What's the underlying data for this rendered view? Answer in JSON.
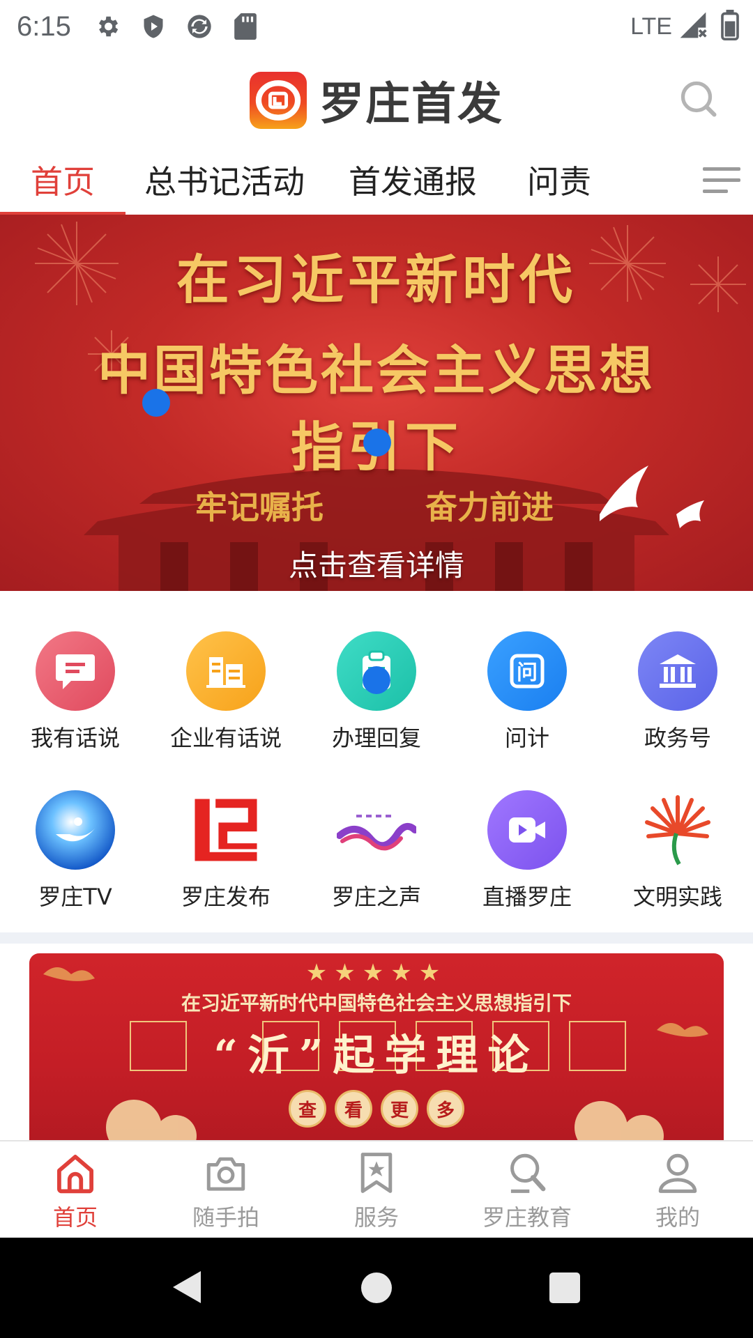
{
  "status_bar": {
    "time": "6:15",
    "network": "LTE"
  },
  "header": {
    "app_name": "罗庄首发"
  },
  "tabs": [
    {
      "label": "首页",
      "active": true
    },
    {
      "label": "总书记活动",
      "active": false
    },
    {
      "label": "首发通报",
      "active": false
    },
    {
      "label": "问责",
      "active": false
    }
  ],
  "banner": {
    "line1": "在习近平新时代",
    "line2": "中国特色社会主义思想",
    "line3": "指引下",
    "sub_left": "牢记嘱托",
    "sub_right": "奋力前进",
    "caption": "点击查看详情"
  },
  "services_row1": [
    {
      "label": "我有话说",
      "icon": "chat-bubble-icon"
    },
    {
      "label": "企业有话说",
      "icon": "building-icon"
    },
    {
      "label": "办理回复",
      "icon": "clipboard-icon"
    },
    {
      "label": "问计",
      "icon": "question-icon"
    },
    {
      "label": "政务号",
      "icon": "government-icon"
    }
  ],
  "services_row2": [
    {
      "label": "罗庄TV",
      "icon": "tv-logo-icon"
    },
    {
      "label": "罗庄发布",
      "icon": "release-logo-icon"
    },
    {
      "label": "罗庄之声",
      "icon": "voice-logo-icon"
    },
    {
      "label": "直播罗庄",
      "icon": "video-icon"
    },
    {
      "label": "文明实践",
      "icon": "civilization-logo-icon"
    }
  ],
  "promo": {
    "stars": "★★★★★",
    "title": "在习近平新时代中国特色社会主义思想指引下",
    "main": "“沂”起学理论",
    "more_chars": [
      "查",
      "看",
      "更",
      "多"
    ]
  },
  "bottom_nav": [
    {
      "label": "首页",
      "active": true
    },
    {
      "label": "随手拍",
      "active": false
    },
    {
      "label": "服务",
      "active": false
    },
    {
      "label": "罗庄教育",
      "active": false
    },
    {
      "label": "我的",
      "active": false
    }
  ],
  "colors": {
    "accent": "#e0403a",
    "banner_red": "#c22a27",
    "nav_inactive": "#9a9a9a"
  }
}
